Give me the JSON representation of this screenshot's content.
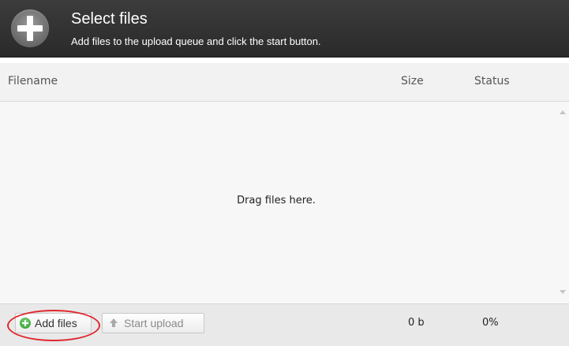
{
  "header": {
    "title": "Select files",
    "subtitle": "Add files to the upload queue and click the start button.",
    "icon": "plus-icon"
  },
  "columns": {
    "filename": "Filename",
    "size": "Size",
    "status": "Status"
  },
  "filelist": {
    "drop_hint": "Drag files here.",
    "files": []
  },
  "footer": {
    "add_files_label": "Add files",
    "add_files_icon": "add-circle-icon",
    "start_upload_label": "Start upload",
    "start_upload_icon": "upload-arrow-icon",
    "total_size": "0 b",
    "total_percent": "0%"
  },
  "colors": {
    "header_background": "#333333",
    "highlight": "#e0282e",
    "add_icon": "#2e9a2e"
  }
}
